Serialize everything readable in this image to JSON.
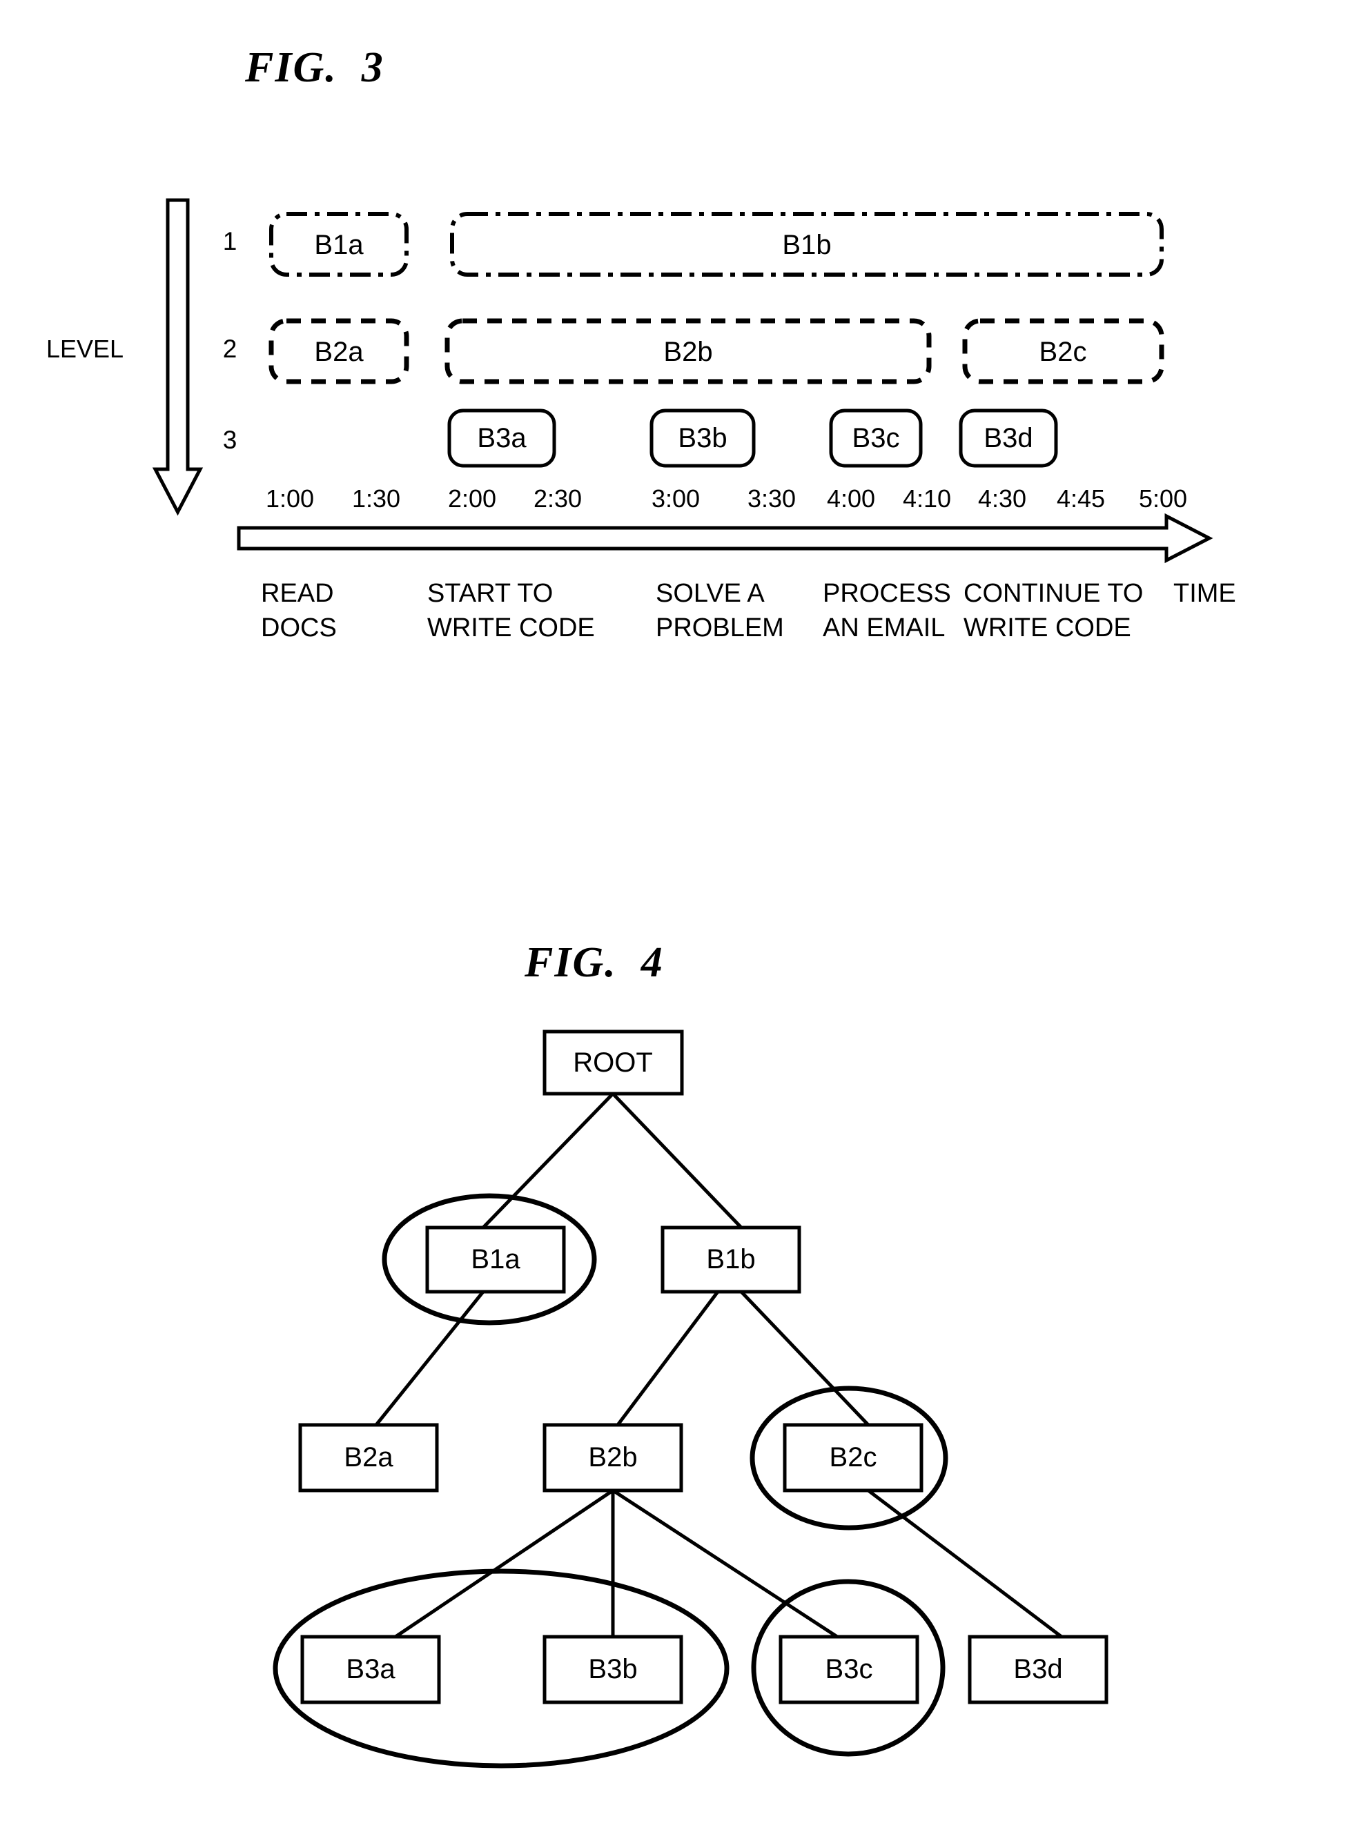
{
  "figures": {
    "fig3": {
      "title": "FIG.  3",
      "axis_y_label": "LEVEL",
      "axis_x_label": "TIME",
      "levels": [
        {
          "number": "1"
        },
        {
          "number": "2"
        },
        {
          "number": "3"
        }
      ],
      "blocks_level1": [
        {
          "label": "B1a",
          "style": "dash-dot"
        },
        {
          "label": "B1b",
          "style": "dash-dot"
        }
      ],
      "blocks_level2": [
        {
          "label": "B2a",
          "style": "dashed"
        },
        {
          "label": "B2b",
          "style": "dashed"
        },
        {
          "label": "B2c",
          "style": "dashed"
        }
      ],
      "blocks_level3": [
        {
          "label": "B3a",
          "style": "solid"
        },
        {
          "label": "B3b",
          "style": "solid"
        },
        {
          "label": "B3c",
          "style": "solid"
        },
        {
          "label": "B3d",
          "style": "solid"
        }
      ],
      "time_ticks": [
        "1:00",
        "1:30",
        "2:00",
        "2:30",
        "3:00",
        "3:30",
        "4:00",
        "4:10",
        "4:30",
        "4:45",
        "5:00"
      ],
      "activities": [
        {
          "line1": "READ",
          "line2": "DOCS"
        },
        {
          "line1": "START TO",
          "line2": "WRITE CODE"
        },
        {
          "line1": "SOLVE A",
          "line2": "PROBLEM"
        },
        {
          "line1": "PROCESS",
          "line2": "AN EMAIL"
        },
        {
          "line1": "CONTINUE TO",
          "line2": "WRITE CODE"
        }
      ]
    },
    "fig4": {
      "title": "FIG.  4",
      "nodes": {
        "root": "ROOT",
        "b1a": "B1a",
        "b1b": "B1b",
        "b2a": "B2a",
        "b2b": "B2b",
        "b2c": "B2c",
        "b3a": "B3a",
        "b3b": "B3b",
        "b3c": "B3c",
        "b3d": "B3d"
      },
      "edges": [
        {
          "from": "root",
          "to": "b1a"
        },
        {
          "from": "root",
          "to": "b1b"
        },
        {
          "from": "b1a",
          "to": "b2a"
        },
        {
          "from": "b1b",
          "to": "b2b"
        },
        {
          "from": "b1b",
          "to": "b2c"
        },
        {
          "from": "b2b",
          "to": "b3a"
        },
        {
          "from": "b2b",
          "to": "b3b"
        },
        {
          "from": "b2b",
          "to": "b3c"
        },
        {
          "from": "b2c",
          "to": "b3d"
        }
      ],
      "highlight_groups": [
        {
          "members": [
            "b1a"
          ]
        },
        {
          "members": [
            "b2c"
          ]
        },
        {
          "members": [
            "b3a",
            "b3b"
          ]
        },
        {
          "members": [
            "b3c"
          ]
        }
      ]
    }
  },
  "colors": {
    "ink": "#000000",
    "paper": "#ffffff"
  }
}
